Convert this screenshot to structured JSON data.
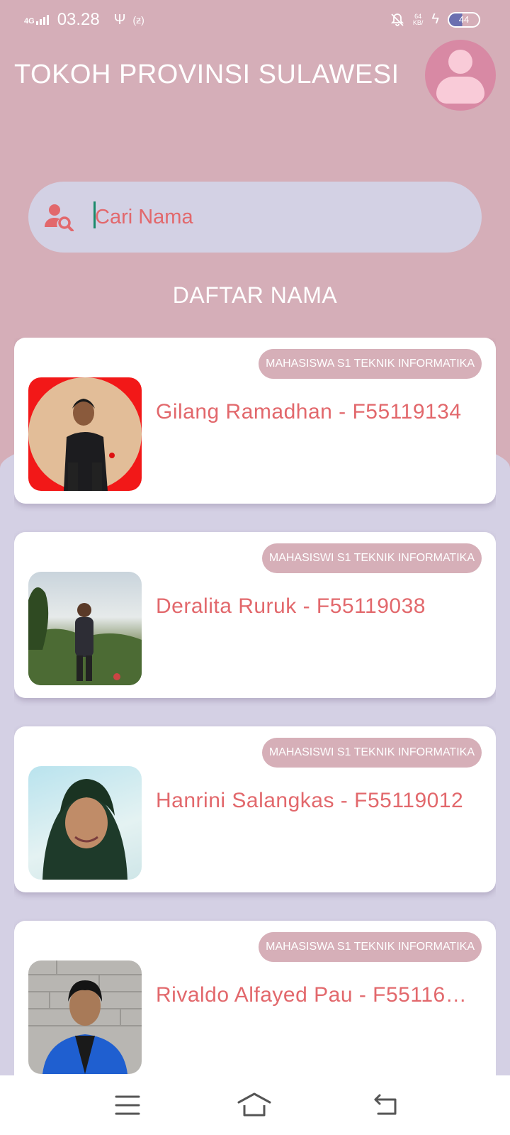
{
  "status_bar": {
    "network": "4G",
    "time": "03.28",
    "speed_value": "64",
    "speed_unit": "KB/",
    "battery": "44",
    "icons": [
      "signal-icon",
      "usb-icon",
      "nfc-icon",
      "mute-icon",
      "charging-icon",
      "battery-icon"
    ]
  },
  "header": {
    "title": "TOKOH PROVINSI SULAWESI",
    "avatar_icon": "user-avatar-icon"
  },
  "search": {
    "placeholder": "Cari Nama",
    "value": "",
    "icon": "user-search-icon"
  },
  "section_title": "DAFTAR NAMA",
  "people": [
    {
      "badge": "MAHASISWA S1 TEKNIK INFORMATIKA",
      "name": "Gilang Ramadhan - F55119134"
    },
    {
      "badge": "MAHASISWI S1 TEKNIK INFORMATIKA",
      "name": "Deralita Ruruk - F55119038"
    },
    {
      "badge": "MAHASISWI S1 TEKNIK INFORMATIKA",
      "name": "Hanrini Salangkas - F55119012"
    },
    {
      "badge": "MAHASISWA S1 TEKNIK INFORMATIKA",
      "name": "Rivaldo Alfayed Pau - F55116…"
    }
  ],
  "nav_bar": {
    "icons": [
      "menu-icon",
      "home-icon",
      "back-icon"
    ]
  },
  "colors": {
    "header_pink": "#d5aeb8",
    "lavender": "#d4d0e4",
    "accent_coral": "#e2686c",
    "avatar_pink": "#d889a4"
  }
}
